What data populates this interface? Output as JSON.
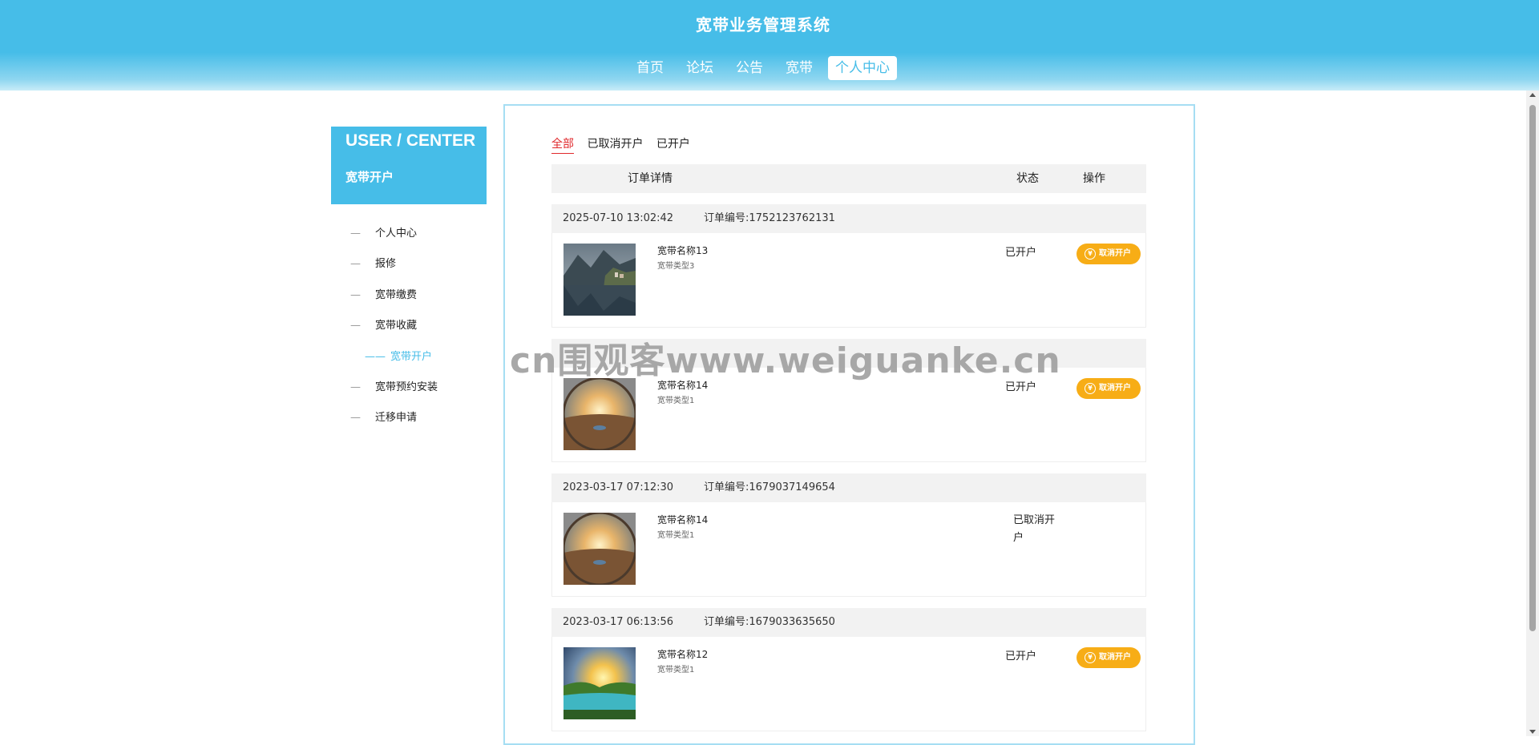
{
  "header": {
    "title": "宽带业务管理系统",
    "nav": [
      "首页",
      "论坛",
      "公告",
      "宽带",
      "个人中心"
    ]
  },
  "sidebar": {
    "title": "USER / CENTER",
    "subtitle": "宽带开户",
    "items": [
      {
        "dash": "—",
        "label": "个人中心"
      },
      {
        "dash": "—",
        "label": "报修"
      },
      {
        "dash": "—",
        "label": "宽带缴费"
      },
      {
        "dash": "—",
        "label": "宽带收藏"
      },
      {
        "dash": "——",
        "label": "宽带开户"
      },
      {
        "dash": "—",
        "label": "宽带预约安装"
      },
      {
        "dash": "—",
        "label": "迁移申请"
      }
    ]
  },
  "tabs": [
    "全部",
    "已取消开户",
    "已开户"
  ],
  "table_header": {
    "detail": "订单详情",
    "status": "状态",
    "action": "操作"
  },
  "orders": [
    {
      "date": "2025-07-10 13:02:42",
      "order_no": "订单编号:1752123762131",
      "name": "宽带名称13",
      "type": "宽带类型3",
      "status": "已开户",
      "action": "取消开户",
      "image": "lake-village-photo"
    },
    {
      "date": "",
      "order_no": "",
      "name": "宽带名称14",
      "type": "宽带类型1",
      "status": "已开户",
      "action": "取消开户",
      "image": "desert-sunset-photo"
    },
    {
      "date": "2023-03-17 07:12:30",
      "order_no": "订单编号:1679037149654",
      "name": "宽带名称14",
      "type": "宽带类型1",
      "status": "已取消开户",
      "action": "",
      "image": "desert-sunset-photo"
    },
    {
      "date": "2023-03-17 06:13:56",
      "order_no": "订单编号:1679033635650",
      "name": "宽带名称12",
      "type": "宽带类型1",
      "status": "已开户",
      "action": "取消开户",
      "image": "sunrise-valley-photo"
    }
  ],
  "watermark": "cn围观客www.weiguanke.cn",
  "colors": {
    "primary": "#46bde8",
    "accent_red": "#e0292c",
    "button_orange": "#f7ad16",
    "row_bg": "#f2f2f2"
  }
}
